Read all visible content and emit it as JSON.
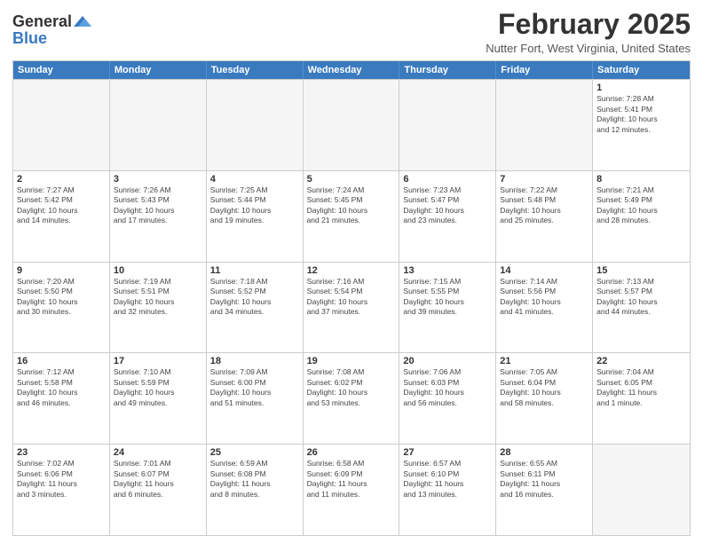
{
  "header": {
    "logo_general": "General",
    "logo_blue": "Blue",
    "month_title": "February 2025",
    "subtitle": "Nutter Fort, West Virginia, United States"
  },
  "calendar": {
    "days_of_week": [
      "Sunday",
      "Monday",
      "Tuesday",
      "Wednesday",
      "Thursday",
      "Friday",
      "Saturday"
    ],
    "weeks": [
      [
        {
          "day": "",
          "info": ""
        },
        {
          "day": "",
          "info": ""
        },
        {
          "day": "",
          "info": ""
        },
        {
          "day": "",
          "info": ""
        },
        {
          "day": "",
          "info": ""
        },
        {
          "day": "",
          "info": ""
        },
        {
          "day": "1",
          "info": "Sunrise: 7:28 AM\nSunset: 5:41 PM\nDaylight: 10 hours\nand 12 minutes."
        }
      ],
      [
        {
          "day": "2",
          "info": "Sunrise: 7:27 AM\nSunset: 5:42 PM\nDaylight: 10 hours\nand 14 minutes."
        },
        {
          "day": "3",
          "info": "Sunrise: 7:26 AM\nSunset: 5:43 PM\nDaylight: 10 hours\nand 17 minutes."
        },
        {
          "day": "4",
          "info": "Sunrise: 7:25 AM\nSunset: 5:44 PM\nDaylight: 10 hours\nand 19 minutes."
        },
        {
          "day": "5",
          "info": "Sunrise: 7:24 AM\nSunset: 5:45 PM\nDaylight: 10 hours\nand 21 minutes."
        },
        {
          "day": "6",
          "info": "Sunrise: 7:23 AM\nSunset: 5:47 PM\nDaylight: 10 hours\nand 23 minutes."
        },
        {
          "day": "7",
          "info": "Sunrise: 7:22 AM\nSunset: 5:48 PM\nDaylight: 10 hours\nand 25 minutes."
        },
        {
          "day": "8",
          "info": "Sunrise: 7:21 AM\nSunset: 5:49 PM\nDaylight: 10 hours\nand 28 minutes."
        }
      ],
      [
        {
          "day": "9",
          "info": "Sunrise: 7:20 AM\nSunset: 5:50 PM\nDaylight: 10 hours\nand 30 minutes."
        },
        {
          "day": "10",
          "info": "Sunrise: 7:19 AM\nSunset: 5:51 PM\nDaylight: 10 hours\nand 32 minutes."
        },
        {
          "day": "11",
          "info": "Sunrise: 7:18 AM\nSunset: 5:52 PM\nDaylight: 10 hours\nand 34 minutes."
        },
        {
          "day": "12",
          "info": "Sunrise: 7:16 AM\nSunset: 5:54 PM\nDaylight: 10 hours\nand 37 minutes."
        },
        {
          "day": "13",
          "info": "Sunrise: 7:15 AM\nSunset: 5:55 PM\nDaylight: 10 hours\nand 39 minutes."
        },
        {
          "day": "14",
          "info": "Sunrise: 7:14 AM\nSunset: 5:56 PM\nDaylight: 10 hours\nand 41 minutes."
        },
        {
          "day": "15",
          "info": "Sunrise: 7:13 AM\nSunset: 5:57 PM\nDaylight: 10 hours\nand 44 minutes."
        }
      ],
      [
        {
          "day": "16",
          "info": "Sunrise: 7:12 AM\nSunset: 5:58 PM\nDaylight: 10 hours\nand 46 minutes."
        },
        {
          "day": "17",
          "info": "Sunrise: 7:10 AM\nSunset: 5:59 PM\nDaylight: 10 hours\nand 49 minutes."
        },
        {
          "day": "18",
          "info": "Sunrise: 7:09 AM\nSunset: 6:00 PM\nDaylight: 10 hours\nand 51 minutes."
        },
        {
          "day": "19",
          "info": "Sunrise: 7:08 AM\nSunset: 6:02 PM\nDaylight: 10 hours\nand 53 minutes."
        },
        {
          "day": "20",
          "info": "Sunrise: 7:06 AM\nSunset: 6:03 PM\nDaylight: 10 hours\nand 56 minutes."
        },
        {
          "day": "21",
          "info": "Sunrise: 7:05 AM\nSunset: 6:04 PM\nDaylight: 10 hours\nand 58 minutes."
        },
        {
          "day": "22",
          "info": "Sunrise: 7:04 AM\nSunset: 6:05 PM\nDaylight: 11 hours\nand 1 minute."
        }
      ],
      [
        {
          "day": "23",
          "info": "Sunrise: 7:02 AM\nSunset: 6:06 PM\nDaylight: 11 hours\nand 3 minutes."
        },
        {
          "day": "24",
          "info": "Sunrise: 7:01 AM\nSunset: 6:07 PM\nDaylight: 11 hours\nand 6 minutes."
        },
        {
          "day": "25",
          "info": "Sunrise: 6:59 AM\nSunset: 6:08 PM\nDaylight: 11 hours\nand 8 minutes."
        },
        {
          "day": "26",
          "info": "Sunrise: 6:58 AM\nSunset: 6:09 PM\nDaylight: 11 hours\nand 11 minutes."
        },
        {
          "day": "27",
          "info": "Sunrise: 6:57 AM\nSunset: 6:10 PM\nDaylight: 11 hours\nand 13 minutes."
        },
        {
          "day": "28",
          "info": "Sunrise: 6:55 AM\nSunset: 6:11 PM\nDaylight: 11 hours\nand 16 minutes."
        },
        {
          "day": "",
          "info": ""
        }
      ]
    ]
  }
}
